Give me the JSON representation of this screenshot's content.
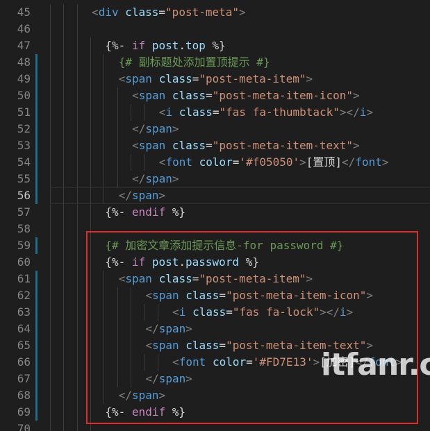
{
  "watermark": "itfanr.cc",
  "colors": {
    "background": "#1e1e1e",
    "line_number": "#858585",
    "tag": "#569cd6",
    "attribute": "#9cdcfe",
    "string": "#ce9178",
    "comment": "#6a9955",
    "keyword": "#c586c0",
    "highlight_box": "#e02b2b",
    "git_modified_marker": "#1f6f8b"
  },
  "editor": {
    "current_line": 56,
    "lines": [
      {
        "n": 45,
        "indent": 3,
        "tokens": [
          [
            "punct",
            "<"
          ],
          [
            "tag",
            "div"
          ],
          [
            "text",
            " "
          ],
          [
            "attr",
            "class"
          ],
          [
            "eq",
            "="
          ],
          [
            "str",
            "\"post-meta\""
          ],
          [
            "punct",
            ">"
          ]
        ]
      },
      {
        "n": 46,
        "indent": 3,
        "tokens": []
      },
      {
        "n": 47,
        "indent": 4,
        "tokens": [
          [
            "ctl",
            "{%- "
          ],
          [
            "kw",
            "if"
          ],
          [
            "text",
            " "
          ],
          [
            "var",
            "post"
          ],
          [
            "ctl",
            "."
          ],
          [
            "var",
            "top"
          ],
          [
            "ctl",
            " %}"
          ]
        ]
      },
      {
        "n": 48,
        "indent": 5,
        "mod": true,
        "tokens": [
          [
            "cmt",
            "{# 副标题处添加置顶提示 #}"
          ]
        ]
      },
      {
        "n": 49,
        "indent": 5,
        "mod": true,
        "tokens": [
          [
            "punct",
            "<"
          ],
          [
            "tag",
            "span"
          ],
          [
            "text",
            " "
          ],
          [
            "attr",
            "class"
          ],
          [
            "eq",
            "="
          ],
          [
            "str",
            "\"post-meta-item\""
          ],
          [
            "punct",
            ">"
          ]
        ]
      },
      {
        "n": 50,
        "indent": 6,
        "mod": true,
        "tokens": [
          [
            "punct",
            "<"
          ],
          [
            "tag",
            "span"
          ],
          [
            "text",
            " "
          ],
          [
            "attr",
            "class"
          ],
          [
            "eq",
            "="
          ],
          [
            "str",
            "\"post-meta-item-icon\""
          ],
          [
            "punct",
            ">"
          ]
        ]
      },
      {
        "n": 51,
        "indent": 8,
        "mod": true,
        "tokens": [
          [
            "punct",
            "<"
          ],
          [
            "tag",
            "i"
          ],
          [
            "text",
            " "
          ],
          [
            "attr",
            "class"
          ],
          [
            "eq",
            "="
          ],
          [
            "str",
            "\"fas fa-thumbtack\""
          ],
          [
            "punct",
            "></"
          ],
          [
            "tag",
            "i"
          ],
          [
            "punct",
            ">"
          ]
        ]
      },
      {
        "n": 52,
        "indent": 6,
        "mod": true,
        "tokens": [
          [
            "punct",
            "</"
          ],
          [
            "tag",
            "span"
          ],
          [
            "punct",
            ">"
          ]
        ]
      },
      {
        "n": 53,
        "indent": 6,
        "mod": true,
        "tokens": [
          [
            "punct",
            "<"
          ],
          [
            "tag",
            "span"
          ],
          [
            "text",
            " "
          ],
          [
            "attr",
            "class"
          ],
          [
            "eq",
            "="
          ],
          [
            "str",
            "\"post-meta-item-text\""
          ],
          [
            "punct",
            ">"
          ]
        ]
      },
      {
        "n": 54,
        "indent": 8,
        "mod": true,
        "tokens": [
          [
            "punct",
            "<"
          ],
          [
            "tag",
            "font"
          ],
          [
            "text",
            " "
          ],
          [
            "attr",
            "color"
          ],
          [
            "eq",
            "="
          ],
          [
            "str",
            "'#f05050'"
          ],
          [
            "punct",
            ">"
          ],
          [
            "text",
            "[置顶]"
          ],
          [
            "punct",
            "</"
          ],
          [
            "tag",
            "font"
          ],
          [
            "punct",
            ">"
          ]
        ]
      },
      {
        "n": 55,
        "indent": 6,
        "mod": true,
        "tokens": [
          [
            "punct",
            "</"
          ],
          [
            "tag",
            "span"
          ],
          [
            "punct",
            ">"
          ]
        ]
      },
      {
        "n": 56,
        "indent": 5,
        "mod": true,
        "tokens": [
          [
            "punct",
            "</"
          ],
          [
            "tag",
            "span"
          ],
          [
            "punct",
            ">"
          ]
        ]
      },
      {
        "n": 57,
        "indent": 4,
        "tokens": [
          [
            "ctl",
            "{%- "
          ],
          [
            "kw",
            "endif"
          ],
          [
            "ctl",
            " %}"
          ]
        ]
      },
      {
        "n": 58,
        "indent": 4,
        "tokens": []
      },
      {
        "n": 59,
        "indent": 4,
        "mod": true,
        "tokens": [
          [
            "cmt",
            "{# 加密文章添加提示信息-for password #}"
          ]
        ]
      },
      {
        "n": 60,
        "indent": 4,
        "tokens": [
          [
            "ctl",
            "{%- "
          ],
          [
            "kw",
            "if"
          ],
          [
            "text",
            " "
          ],
          [
            "var",
            "post"
          ],
          [
            "ctl",
            "."
          ],
          [
            "var",
            "password"
          ],
          [
            "ctl",
            " %}"
          ]
        ]
      },
      {
        "n": 61,
        "indent": 5,
        "mod": true,
        "tokens": [
          [
            "punct",
            "<"
          ],
          [
            "tag",
            "span"
          ],
          [
            "text",
            " "
          ],
          [
            "attr",
            "class"
          ],
          [
            "eq",
            "="
          ],
          [
            "str",
            "\"post-meta-item\""
          ],
          [
            "punct",
            ">"
          ]
        ]
      },
      {
        "n": 62,
        "indent": 7,
        "mod": true,
        "tokens": [
          [
            "punct",
            "<"
          ],
          [
            "tag",
            "span"
          ],
          [
            "text",
            " "
          ],
          [
            "attr",
            "class"
          ],
          [
            "eq",
            "="
          ],
          [
            "str",
            "\"post-meta-item-icon\""
          ],
          [
            "punct",
            ">"
          ]
        ]
      },
      {
        "n": 63,
        "indent": 9,
        "mod": true,
        "tokens": [
          [
            "punct",
            "<"
          ],
          [
            "tag",
            "i"
          ],
          [
            "text",
            " "
          ],
          [
            "attr",
            "class"
          ],
          [
            "eq",
            "="
          ],
          [
            "str",
            "\"fas fa-lock\""
          ],
          [
            "punct",
            "></"
          ],
          [
            "tag",
            "i"
          ],
          [
            "punct",
            ">"
          ]
        ]
      },
      {
        "n": 64,
        "indent": 7,
        "mod": true,
        "tokens": [
          [
            "punct",
            "</"
          ],
          [
            "tag",
            "span"
          ],
          [
            "punct",
            ">"
          ]
        ]
      },
      {
        "n": 65,
        "indent": 7,
        "mod": true,
        "tokens": [
          [
            "punct",
            "<"
          ],
          [
            "tag",
            "span"
          ],
          [
            "text",
            " "
          ],
          [
            "attr",
            "class"
          ],
          [
            "eq",
            "="
          ],
          [
            "str",
            "\"post-meta-item-text\""
          ],
          [
            "punct",
            ">"
          ]
        ]
      },
      {
        "n": 66,
        "indent": 9,
        "mod": true,
        "tokens": [
          [
            "punct",
            "<"
          ],
          [
            "tag",
            "font"
          ],
          [
            "text",
            " "
          ],
          [
            "attr",
            "color"
          ],
          [
            "eq",
            "="
          ],
          [
            "str",
            "'#FD7E13'"
          ],
          [
            "punct",
            ">"
          ],
          [
            "text",
            "[加密]"
          ],
          [
            "punct",
            "</"
          ],
          [
            "tag",
            "font"
          ],
          [
            "punct",
            ">"
          ]
        ]
      },
      {
        "n": 67,
        "indent": 7,
        "mod": true,
        "tokens": [
          [
            "punct",
            "</"
          ],
          [
            "tag",
            "span"
          ],
          [
            "punct",
            ">"
          ]
        ]
      },
      {
        "n": 68,
        "indent": 5,
        "mod": true,
        "tokens": [
          [
            "punct",
            "</"
          ],
          [
            "tag",
            "span"
          ],
          [
            "punct",
            ">"
          ]
        ]
      },
      {
        "n": 69,
        "indent": 4,
        "mod": true,
        "tokens": [
          [
            "ctl",
            "{%- "
          ],
          [
            "kw",
            "endif"
          ],
          [
            "ctl",
            " %}"
          ]
        ]
      },
      {
        "n": 70,
        "indent": 4,
        "tokens": []
      }
    ]
  }
}
